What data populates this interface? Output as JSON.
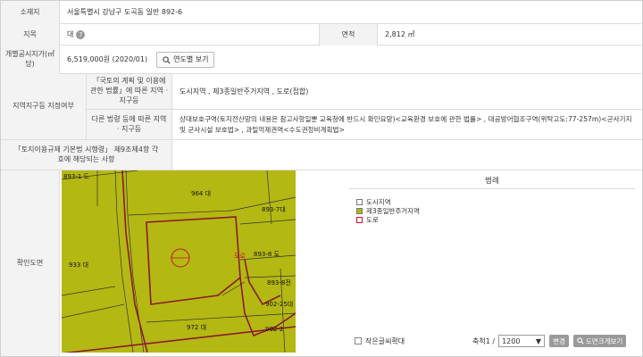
{
  "address": {
    "label": "소재지",
    "value": "서울특별시 강남구 도곡동 일반 892-6"
  },
  "landInfo": {
    "jimok_label": "지목",
    "jimok_value": "대",
    "area_label": "면적",
    "area_value": "2,812 ㎡",
    "price_label": "개별공시지가(㎡당)",
    "price_value": "6,519,000원 (2020/01)",
    "price_button": "연도별 보기"
  },
  "zoning": {
    "section_label": "지역지구등 지정여부",
    "act_label": "「국토의 계획 및 이용에 관한 법률」에 따른 지역 · 지구등",
    "act_value": "도시지역 , 제3종일반주거지역 , 도로(접합)",
    "other_label": "다른 법령 등에 따른 지역 · 지구등",
    "other_value": "상대보호구역(토지전산망의 내용은 참고사항일뿐 교육청에 반드시 확인요망)<교육환경 보호에 관한 법률> , 대공방어협조구역(위탁고도:77-257m)<군사기지 및 군사시설 보호법> , 과밀억제권역<수도권정비계획법>",
    "decree_label": "「토지이용규제 기본법 시행령」 제9조제4항 각 호에 해당되는 사항",
    "decree_value": ""
  },
  "mapSection": {
    "label": "확인도면",
    "legend_title": "범례",
    "legend_items": [
      {
        "label": "도시지역",
        "color": "#ffffff"
      },
      {
        "label": "제3종일반주거지역",
        "color": "#b4b812"
      },
      {
        "label": "도로",
        "color": "#ffffff"
      }
    ],
    "map_labels": [
      "964 대",
      "893-7대",
      "893-1 도",
      "893-8 도",
      "933 대",
      "972 대",
      "902-25대",
      "902-2",
      "893-8전",
      "도로"
    ],
    "checkbox_label": "작은글씨확대",
    "scale_label": "축척1 /",
    "scale_value": "1200",
    "change_button": "변경",
    "zoom_button": "도면크게보기"
  },
  "colors": {
    "map_bg": "#b4b812",
    "parcel_line": "#8b1a2a"
  }
}
